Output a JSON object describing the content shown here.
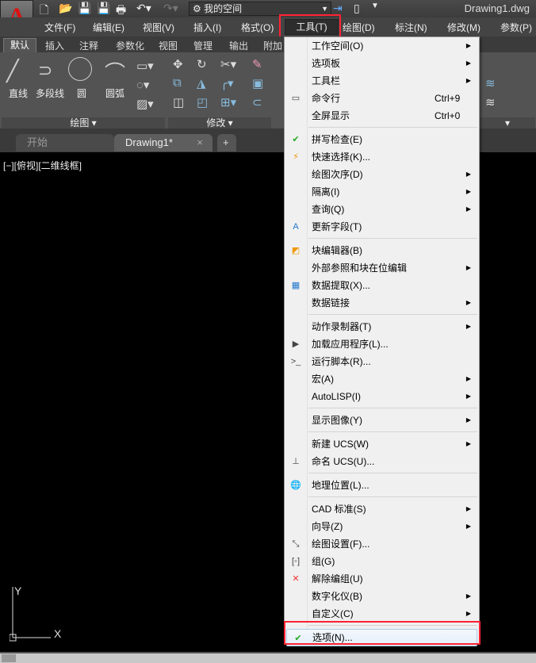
{
  "app": {
    "logo": "A",
    "document_title": "Drawing1.dwg",
    "workspace": "我的空间"
  },
  "menubar": [
    "文件(F)",
    "编辑(E)",
    "视图(V)",
    "插入(I)",
    "格式(O)",
    "工具(T)",
    "绘图(D)",
    "标注(N)",
    "修改(M)",
    "参数(P)"
  ],
  "ribbon_tabs": [
    "默认",
    "插入",
    "注释",
    "参数化",
    "视图",
    "管理",
    "输出",
    "附加"
  ],
  "draw_panel": {
    "title": "绘图",
    "tools": [
      "直线",
      "多段线",
      "圆",
      "圆弧"
    ]
  },
  "modify_panel": {
    "title": "修改"
  },
  "file_tabs": {
    "start": "开始",
    "drawing": "Drawing1*",
    "new": "+"
  },
  "viewport_label": "[−][俯视][二维线框]",
  "ucs": {
    "x": "X",
    "y": "Y"
  },
  "tools_menu": [
    {
      "label": "工作空间(O)",
      "sub": true
    },
    {
      "label": "选项板",
      "sub": true
    },
    {
      "label": "工具栏",
      "sub": true
    },
    {
      "label": "命令行",
      "shortcut": "Ctrl+9",
      "icon": "command-line-icon"
    },
    {
      "label": "全屏显示",
      "shortcut": "Ctrl+0"
    },
    {
      "sep": true
    },
    {
      "label": "拼写检查(E)",
      "icon": "spell-check-icon"
    },
    {
      "label": "快速选择(K)...",
      "icon": "quick-select-icon"
    },
    {
      "label": "绘图次序(D)",
      "sub": true
    },
    {
      "label": "隔离(I)",
      "sub": true
    },
    {
      "label": "查询(Q)",
      "sub": true
    },
    {
      "label": "更新字段(T)",
      "icon": "update-field-icon"
    },
    {
      "sep": true
    },
    {
      "label": "块编辑器(B)",
      "icon": "block-editor-icon"
    },
    {
      "label": "外部参照和块在位编辑",
      "sub": true
    },
    {
      "label": "数据提取(X)...",
      "icon": "data-extraction-icon"
    },
    {
      "label": "数据链接",
      "sub": true
    },
    {
      "sep": true
    },
    {
      "label": "动作录制器(T)",
      "sub": true
    },
    {
      "label": "加载应用程序(L)...",
      "icon": "load-application-icon"
    },
    {
      "label": "运行脚本(R)...",
      "icon": "run-script-icon"
    },
    {
      "label": "宏(A)",
      "sub": true
    },
    {
      "label": "AutoLISP(I)",
      "sub": true
    },
    {
      "sep": true
    },
    {
      "label": "显示图像(Y)",
      "sub": true
    },
    {
      "sep": true
    },
    {
      "label": "新建 UCS(W)",
      "sub": true
    },
    {
      "label": "命名 UCS(U)...",
      "icon": "named-ucs-icon"
    },
    {
      "sep": true
    },
    {
      "label": "地理位置(L)...",
      "icon": "globe-icon"
    },
    {
      "sep": true
    },
    {
      "label": "CAD 标准(S)",
      "sub": true
    },
    {
      "label": "向导(Z)",
      "sub": true
    },
    {
      "label": "绘图设置(F)...",
      "icon": "drafting-settings-icon"
    },
    {
      "label": "组(G)",
      "icon": "group-icon"
    },
    {
      "label": "解除编组(U)",
      "icon": "ungroup-icon"
    },
    {
      "label": "数字化仪(B)",
      "sub": true
    },
    {
      "label": "自定义(C)",
      "sub": true
    },
    {
      "sep": true
    },
    {
      "label": "选项(N)...",
      "icon": "checkmark-icon",
      "highlighted": true
    }
  ],
  "colors": {
    "highlight_box": "#f23",
    "accent": "#d11"
  }
}
